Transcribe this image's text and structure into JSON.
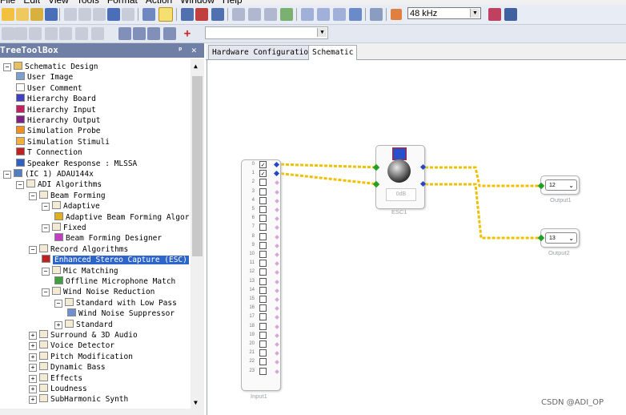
{
  "menu": [
    "File",
    "Edit",
    "View",
    "Tools",
    "Format",
    "Action",
    "Window",
    "Help"
  ],
  "toolbar": {
    "sample_rate": "48 kHz"
  },
  "toolbox": {
    "title": "TreeToolBox",
    "pin_glyph": "ᵖ",
    "close_glyph": "✕"
  },
  "tree": [
    {
      "label": "Schematic Design",
      "indent": 0,
      "icon": "folder-pencil-icon",
      "expander": "−"
    },
    {
      "label": "User Image",
      "indent": 1,
      "icon": "image-icon"
    },
    {
      "label": "User Comment",
      "indent": 1,
      "icon": "text-icon"
    },
    {
      "label": "Hierarchy Board",
      "indent": 1,
      "icon": "board-icon"
    },
    {
      "label": "Hierarchy Input",
      "indent": 1,
      "icon": "input-icon"
    },
    {
      "label": "Hierarchy Output",
      "indent": 1,
      "icon": "output-icon"
    },
    {
      "label": "Simulation Probe",
      "indent": 1,
      "icon": "probe-icon"
    },
    {
      "label": "Simulation Stimuli",
      "indent": 1,
      "icon": "stimuli-icon"
    },
    {
      "label": "T Connection",
      "indent": 1,
      "icon": "t-connection-icon"
    },
    {
      "label": "Speaker Response : MLSSA",
      "indent": 1,
      "icon": "speaker-icon"
    },
    {
      "label": "(IC 1) ADAU144x",
      "indent": 0,
      "icon": "chip-icon",
      "expander": "−"
    },
    {
      "label": "ADI Algorithms",
      "indent": 1,
      "icon": "folder-icon",
      "expander": "−"
    },
    {
      "label": "Beam Forming",
      "indent": 2,
      "icon": "folder-icon",
      "expander": "−"
    },
    {
      "label": "Adaptive",
      "indent": 3,
      "icon": "folder-icon",
      "expander": "−"
    },
    {
      "label": "Adaptive Beam Forming Algorith",
      "indent": 4,
      "icon": "algorithm-icon"
    },
    {
      "label": "Fixed",
      "indent": 3,
      "icon": "folder-icon",
      "expander": "−"
    },
    {
      "label": "Beam Forming Designer",
      "indent": 4,
      "icon": "star-icon"
    },
    {
      "label": "Record Algorithms",
      "indent": 2,
      "icon": "folder-icon",
      "expander": "−"
    },
    {
      "label": "Enhanced Stereo Capture (ESC)",
      "indent": 3,
      "icon": "esc-icon",
      "selected": true
    },
    {
      "label": "Mic Matching",
      "indent": 3,
      "icon": "folder-icon",
      "expander": "−"
    },
    {
      "label": "Offline Microphone Match",
      "indent": 4,
      "icon": "chart-icon"
    },
    {
      "label": "Wind Noise Reduction",
      "indent": 3,
      "icon": "folder-icon",
      "expander": "−"
    },
    {
      "label": "Standard with Low Pass",
      "indent": 4,
      "icon": "folder-icon",
      "expander": "−"
    },
    {
      "label": "Wind Noise Suppressor",
      "indent": 5,
      "icon": "wind-icon"
    },
    {
      "label": "Standard",
      "indent": 4,
      "icon": "folder-icon",
      "expander": "+"
    },
    {
      "label": "Surround & 3D Audio",
      "indent": 2,
      "icon": "folder-icon",
      "expander": "+"
    },
    {
      "label": "Voice Detector",
      "indent": 2,
      "icon": "folder-icon",
      "expander": "+"
    },
    {
      "label": "Pitch Modification",
      "indent": 2,
      "icon": "folder-icon",
      "expander": "+"
    },
    {
      "label": "Dynamic Bass",
      "indent": 2,
      "icon": "folder-icon",
      "expander": "+"
    },
    {
      "label": "Effects",
      "indent": 2,
      "icon": "folder-icon",
      "expander": "+"
    },
    {
      "label": "Loudness",
      "indent": 2,
      "icon": "folder-icon",
      "expander": "+"
    },
    {
      "label": "SubHarmonic Synth",
      "indent": 2,
      "icon": "folder-icon",
      "expander": "+"
    }
  ],
  "tabs": [
    {
      "label": "Hardware Configuration",
      "active": false
    },
    {
      "label": "Schematic",
      "active": true
    }
  ],
  "schematic": {
    "input_block": {
      "label": "Input1",
      "channels": [
        "0",
        "1",
        "2",
        "3",
        "4",
        "5",
        "6",
        "7",
        "8",
        "9",
        "10",
        "11",
        "12",
        "13",
        "14",
        "15",
        "16",
        "17",
        "18",
        "19",
        "20",
        "21",
        "22",
        "23"
      ],
      "checked": [
        0,
        1
      ]
    },
    "esc_block": {
      "label": "ESC1",
      "value": "0dB"
    },
    "outputs": [
      {
        "label": "Output1",
        "value": "12"
      },
      {
        "label": "Output2",
        "value": "13"
      }
    ]
  },
  "watermark": "CSDN @ADI_OP",
  "colors": {
    "wire": "#f0c000",
    "selection": "#2d65c8",
    "panel_header": "#6f7fa6"
  }
}
